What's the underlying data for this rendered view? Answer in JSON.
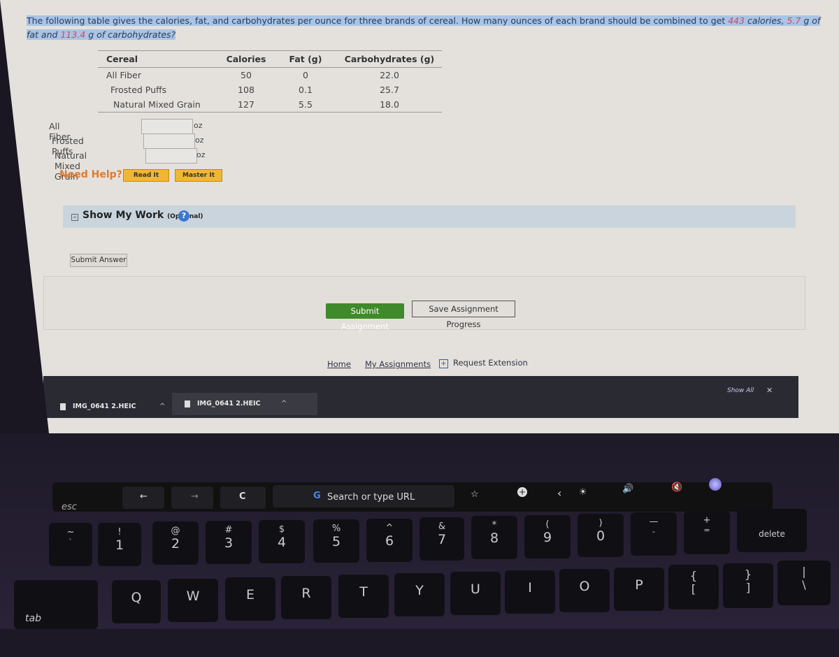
{
  "question": {
    "text_before": "The following table gives the calories, fat, and carbohydrates per ounce for three brands of cereal. How many ounces of each brand should be combined to get ",
    "calories_value": "443",
    "calories_text": " calories, ",
    "fat_value": "5.7",
    "fat_text": " g of fat and ",
    "carbs_value": "113.4",
    "carbs_text": " g of carbohydrates?"
  },
  "table": {
    "headers": [
      "Cereal",
      "Calories",
      "Fat (g)",
      "Carbohydrates (g)"
    ],
    "rows": [
      [
        "All Fiber",
        "50",
        "0",
        "22.0"
      ],
      [
        "Frosted Puffs",
        "108",
        "0.1",
        "25.7"
      ],
      [
        "Natural Mixed Grain",
        "127",
        "5.5",
        "18.0"
      ]
    ]
  },
  "answers": [
    {
      "label": "All Fiber",
      "value": "",
      "unit": "oz"
    },
    {
      "label": "Frosted Puffs",
      "value": "",
      "unit": "oz"
    },
    {
      "label": "Natural Mixed Grain",
      "value": "",
      "unit": "oz"
    }
  ],
  "help": {
    "label": "Need Help?",
    "read_it": "Read It",
    "master_it": "Master It"
  },
  "show_work": {
    "toggle": "+",
    "title": "Show My Work",
    "optional": "(Optional)",
    "help_icon": "?"
  },
  "submit_answer": "Submit Answer",
  "assignment": {
    "submit": "Submit Assignment",
    "save": "Save Assignment Progress"
  },
  "footer": {
    "home": "Home",
    "my_assignments": "My Assignments",
    "request_extension": "Request Extension"
  },
  "downloads": {
    "items": [
      {
        "name": "IMG_0641 2.HEIC"
      },
      {
        "name": "IMG_0641 2.HEIC"
      }
    ],
    "show_all": "Show All",
    "close": "✕"
  },
  "touchbar": {
    "esc": "esc",
    "back": "←",
    "forward": "→",
    "reload": "C",
    "search": "Search or type URL",
    "bookmark": "☆",
    "new_tab": "+",
    "collapse": "‹",
    "brightness": "☀",
    "volume": "🔊",
    "mute": "🔇"
  },
  "keys": {
    "number_row": [
      {
        "top": "~",
        "bot": "`"
      },
      {
        "top": "!",
        "bot": "1"
      },
      {
        "top": "@",
        "bot": "2"
      },
      {
        "top": "#",
        "bot": "3"
      },
      {
        "top": "$",
        "bot": "4"
      },
      {
        "top": "%",
        "bot": "5"
      },
      {
        "top": "^",
        "bot": "6"
      },
      {
        "top": "&",
        "bot": "7"
      },
      {
        "top": "*",
        "bot": "8"
      },
      {
        "top": "(",
        "bot": "9"
      },
      {
        "top": ")",
        "bot": "0"
      },
      {
        "top": "—",
        "bot": "-"
      },
      {
        "top": "+",
        "bot": "="
      }
    ],
    "delete": "delete",
    "tab": "tab",
    "letter_row": [
      "Q",
      "W",
      "E",
      "R",
      "T",
      "Y",
      "U",
      "I",
      "O",
      "P"
    ],
    "brackets": [
      {
        "top": "{",
        "bot": "["
      },
      {
        "top": "}",
        "bot": "]"
      },
      {
        "top": "|",
        "bot": "\\"
      }
    ]
  },
  "colors": {
    "highlight": "#a9c4e6",
    "target_values": "#d24a5a",
    "need_help": "#e07a2e",
    "help_buttons": "#f2b635",
    "submit_assignment": "#3f8a2a"
  }
}
